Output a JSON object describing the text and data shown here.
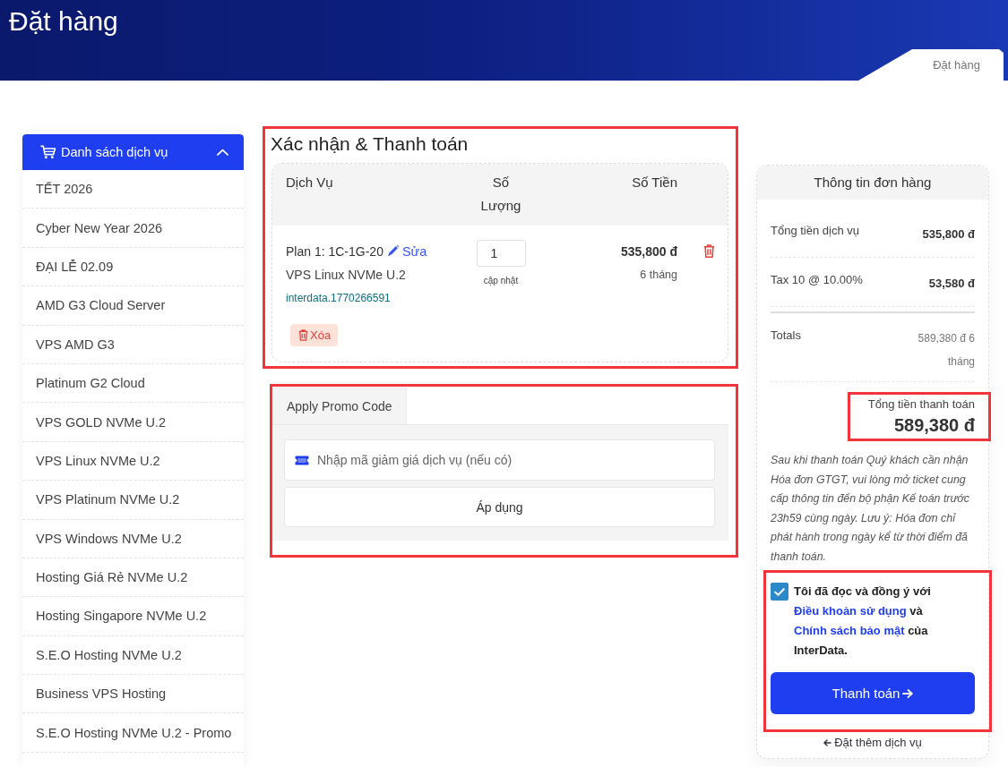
{
  "header": {
    "title": "Đặt hàng",
    "breadcrumb": "Đặt hàng"
  },
  "sidebar": {
    "title": "Danh sách dịch vụ",
    "expanded": true,
    "items": [
      "TẾT 2026",
      "Cyber New Year 2026",
      "ĐẠI LỄ 02.09",
      "AMD G3 Cloud Server",
      "VPS AMD G3",
      "Platinum G2 Cloud",
      "VPS GOLD NVMe U.2",
      "VPS Linux NVMe U.2",
      "VPS Platinum NVMe U.2",
      "VPS Windows NVMe U.2",
      "Hosting Giá Rẻ NVMe U.2",
      "Hosting Singapore NVMe U.2",
      "S.E.O Hosting NVMe U.2",
      "Business VPS Hosting",
      "S.E.O Hosting NVMe U.2 - Promo"
    ]
  },
  "order": {
    "highlighted": true,
    "title": "Xác nhận & Thanh toán",
    "columns": [
      "Dịch Vụ",
      "Số Lượng",
      "Số Tiền"
    ],
    "items": [
      {
        "plan": "Plan 1: 1C-1G-20",
        "edit": "Sửa",
        "product": "VPS Linux NVMe U.2",
        "hostname": "interdata.1770266591",
        "quantity": "1",
        "update": "cập nhật",
        "price": "535,800 đ",
        "period": "6 tháng",
        "remove": "Xóa"
      }
    ]
  },
  "promo": {
    "highlighted": true,
    "tabs": [
      {
        "label": "Apply Promo Code",
        "selected": true
      }
    ],
    "placeholder": "Nhập mã giảm giá dịch vụ (nếu có)",
    "button": "Áp dụng"
  },
  "summary": {
    "title": "Thông tin đơn hàng",
    "lines": [
      {
        "kind": "item",
        "label": "Tổng tiền dịch vụ",
        "value": "535,800 đ"
      },
      {
        "kind": "item",
        "label": "Tax 10 @ 10.00%",
        "value": "53,580 đ"
      },
      {
        "kind": "total",
        "label": "Totals",
        "value": "589,380 đ 6 tháng"
      }
    ],
    "total": {
      "highlighted": true,
      "label": "Tổng tiền thanh toán",
      "value": "589,380 đ"
    },
    "note": "Sau khi thanh toán Quý khách cần nhận Hóa đơn GTGT, vui lòng mở ticket cung cấp thông tin đến bộ phận Kế toán trước 23h59 cùng ngày. Lưu ý: Hóa đơn chỉ phát hành trong ngày kể từ thời điểm đã thanh toán.",
    "agreement": {
      "highlighted": true,
      "checked": true,
      "parts": [
        {
          "kind": "text",
          "text": "Tôi đã đọc và đồng ý với "
        },
        {
          "kind": "link",
          "text": "Điều khoản sử dụng"
        },
        {
          "kind": "text",
          "text": " và "
        },
        {
          "kind": "link",
          "text": "Chính sách bảo mật"
        },
        {
          "kind": "text",
          "text": " của InterData."
        }
      ]
    },
    "pay_button": "Thanh toán",
    "back_link": "Đặt thêm dịch vụ"
  }
}
